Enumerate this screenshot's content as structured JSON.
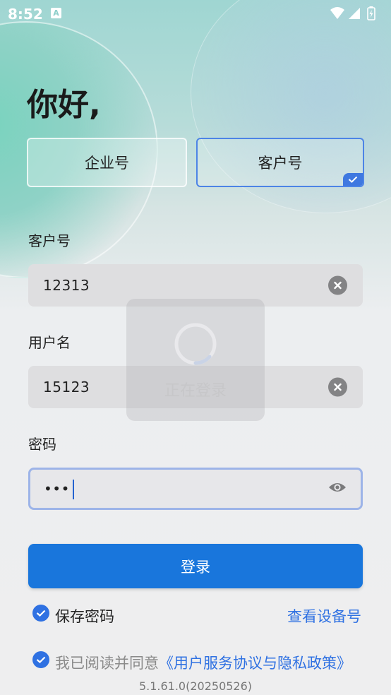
{
  "status_bar": {
    "time": "8:52",
    "app_icon_letter": "A"
  },
  "greeting": "你好,",
  "account_type": {
    "company": "企业号",
    "customer": "客户号",
    "selected": "customer"
  },
  "fields": {
    "customer_no": {
      "label": "客户号",
      "value": "12313"
    },
    "username": {
      "label": "用户名",
      "value": "15123"
    },
    "password": {
      "label": "密码",
      "value": "•••"
    }
  },
  "login_button": "登录",
  "save_password": {
    "label": "保存密码",
    "checked": true
  },
  "view_device_id": "查看设备号",
  "agreement": {
    "prefix": "我已阅读并同意",
    "link": "《用户服务协议与隐私政策》",
    "checked": true
  },
  "version": "5.1.61.0(20250526)",
  "loading_text": "正在登录",
  "colors": {
    "accent": "#1976dc",
    "link": "#2f71e2"
  }
}
